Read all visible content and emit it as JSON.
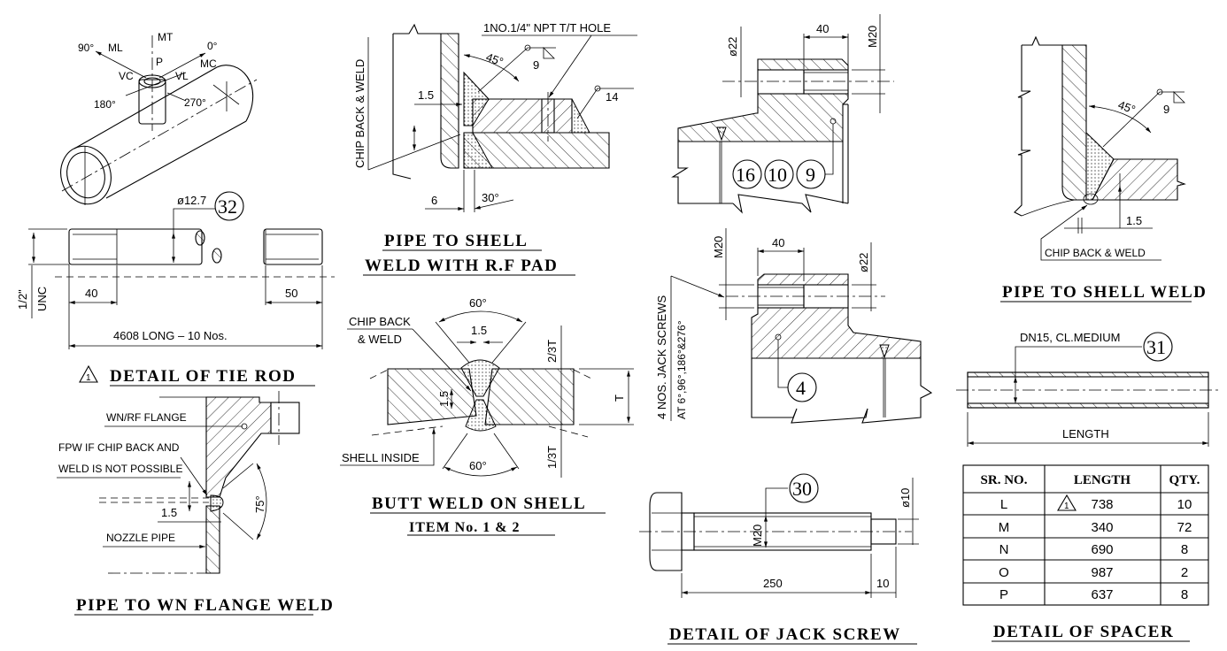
{
  "tie_rod": {
    "title": "DETAIL OF TIE ROD",
    "revision_mark": "1",
    "diameter": "ø12.7",
    "item_no": "32",
    "thread_size": "1/2\"",
    "thread_type": "UNC",
    "left_thread_len": "40",
    "right_thread_len": "50",
    "overall": "4608 LONG – 10 Nos.",
    "nozzle_loads": {
      "mt": "MT",
      "ml": "ML",
      "mc": "MC",
      "vc": "VC",
      "vl": "VL",
      "p": "P",
      "deg0": "0°",
      "deg90": "90°",
      "deg180": "180°",
      "deg270": "270°"
    }
  },
  "pipe_shell_rf": {
    "title_line1": "PIPE TO SHELL",
    "title_line2": "WELD WITH R.F PAD",
    "note_hole": "1NO.1/4\" NPT T/T HOLE",
    "note_chip": "CHIP BACK & WELD",
    "angle_top": "45°",
    "angle_bottom": "30°",
    "weld_size_1": "9",
    "weld_size_2": "14",
    "gap": "1.5",
    "root": "6"
  },
  "butt_weld": {
    "title": "BUTT WELD ON SHELL",
    "subtitle": "ITEM No. 1 & 2",
    "note_chip_1": "CHIP BACK",
    "note_chip_2": "& WELD",
    "note_inside": "SHELL INSIDE",
    "angle_top": "60°",
    "angle_bottom": "60°",
    "gap_top": "1.5",
    "root_face": "1.5",
    "upper_depth": "2/3T",
    "lower_depth": "1/3T",
    "thickness": "T"
  },
  "flange_weld": {
    "title": "PIPE TO WN FLANGE WELD",
    "note_flange": "WN/RF FLANGE",
    "note_fpw_1": "FPW IF CHIP BACK AND",
    "note_fpw_2": "WELD IS NOT POSSIBLE",
    "note_nozzle": "NOZZLE PIPE",
    "gap": "1.5",
    "angle": "75°"
  },
  "jack_boss_top": {
    "bore": "ø22",
    "depth": "40",
    "thread": "M20",
    "items": [
      "16",
      "10",
      "9"
    ]
  },
  "jack_boss_mid": {
    "note_line1": "4 NOS. JACK SCREWS",
    "note_line2": "AT 6°,96°,186°&276°",
    "thread": "M20",
    "depth": "40",
    "bore": "ø22",
    "item": "4"
  },
  "jack_screw": {
    "title": "DETAIL OF JACK SCREW",
    "item_no": "30",
    "thread": "M20",
    "tip_dia": "ø10",
    "length": "250",
    "tip_len": "10"
  },
  "pipe_shell": {
    "title": "PIPE TO SHELL WELD",
    "angle": "45°",
    "weld_size": "9",
    "gap": "1.5",
    "note_chip": "CHIP BACK & WELD"
  },
  "spacer": {
    "title": "DETAIL OF SPACER",
    "pipe_spec": "DN15, CL.MEDIUM",
    "item_no": "31",
    "length_label": "LENGTH",
    "table": {
      "headers": [
        "SR. NO.",
        "LENGTH",
        "QTY."
      ],
      "rows": [
        {
          "sr": "L",
          "length": "738",
          "qty": "10",
          "rev": "1"
        },
        {
          "sr": "M",
          "length": "340",
          "qty": "72",
          "rev": ""
        },
        {
          "sr": "N",
          "length": "690",
          "qty": "8",
          "rev": ""
        },
        {
          "sr": "O",
          "length": "987",
          "qty": "2",
          "rev": ""
        },
        {
          "sr": "P",
          "length": "637",
          "qty": "8",
          "rev": ""
        }
      ]
    }
  }
}
